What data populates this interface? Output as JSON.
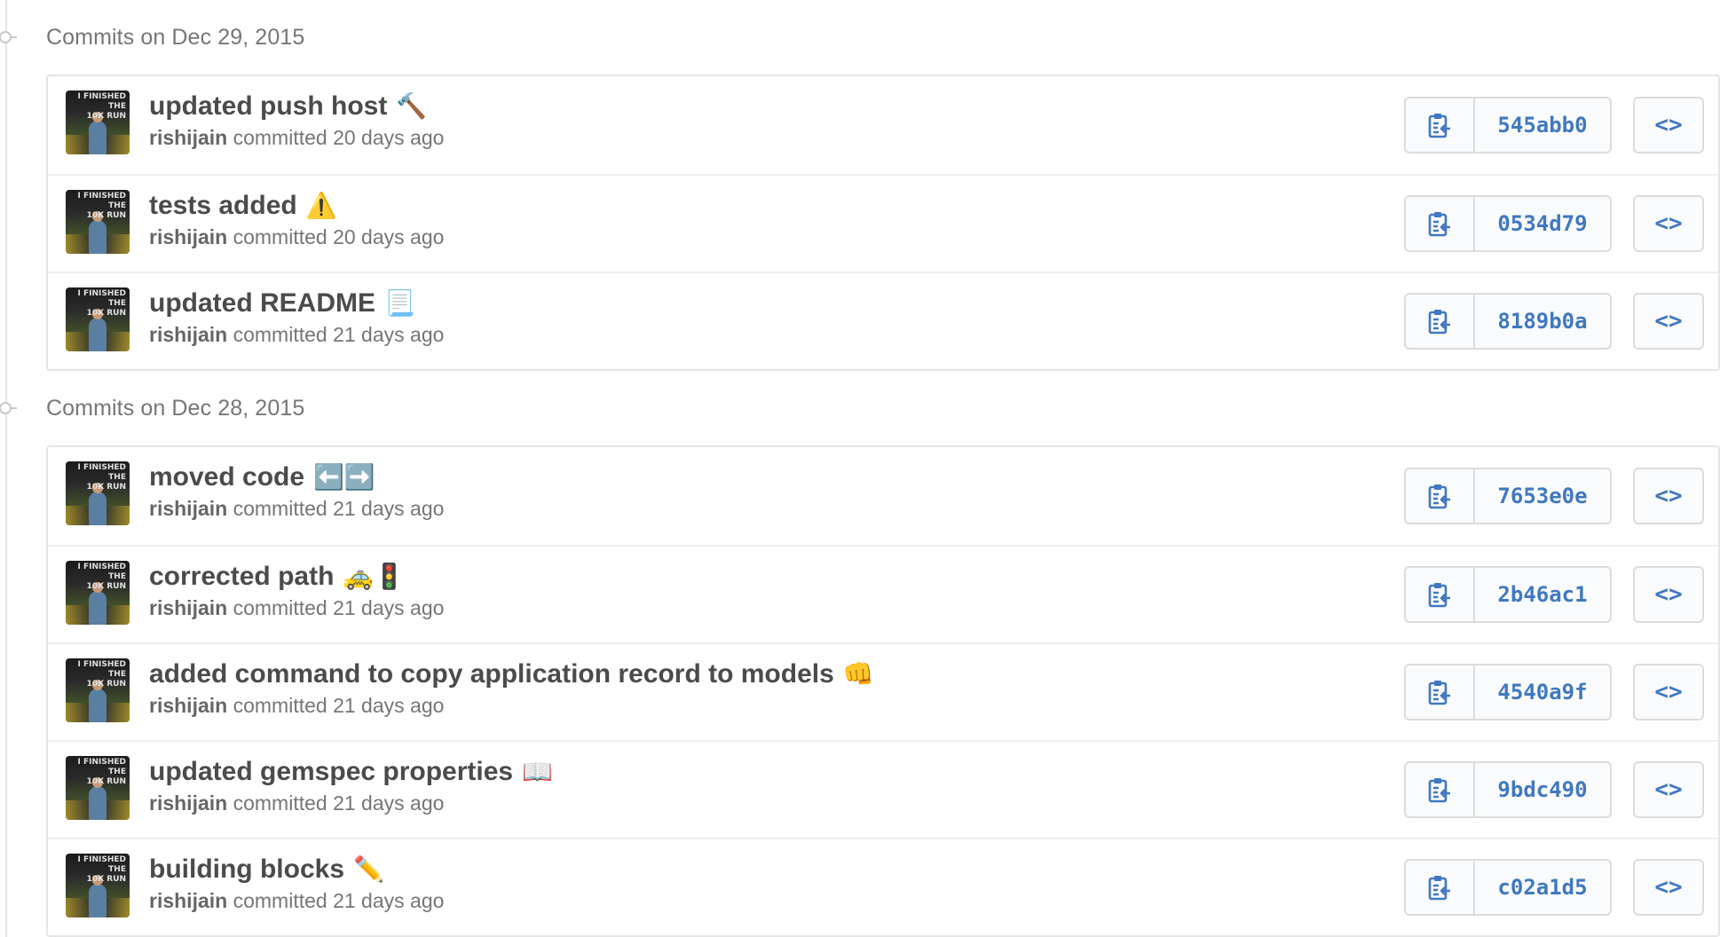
{
  "groups": [
    {
      "title": "Commits on Dec 29, 2015",
      "commits": [
        {
          "message": "updated push host",
          "emoji": "🔨",
          "author": "rishijain",
          "verb": "committed",
          "time": "20 days ago",
          "sha": "545abb0"
        },
        {
          "message": "tests added",
          "emoji": "⚠️",
          "author": "rishijain",
          "verb": "committed",
          "time": "20 days ago",
          "sha": "0534d79"
        },
        {
          "message": "updated README",
          "emoji": "📃",
          "author": "rishijain",
          "verb": "committed",
          "time": "21 days ago",
          "sha": "8189b0a"
        }
      ]
    },
    {
      "title": "Commits on Dec 28, 2015",
      "commits": [
        {
          "message": "moved code",
          "emoji": "⬅️➡️",
          "author": "rishijain",
          "verb": "committed",
          "time": "21 days ago",
          "sha": "7653e0e"
        },
        {
          "message": "corrected path",
          "emoji": "🚕🚦",
          "author": "rishijain",
          "verb": "committed",
          "time": "21 days ago",
          "sha": "2b46ac1"
        },
        {
          "message": "added command to copy application record to models",
          "emoji": "👊",
          "author": "rishijain",
          "verb": "committed",
          "time": "21 days ago",
          "sha": "4540a9f"
        },
        {
          "message": "updated gemspec properties",
          "emoji": "📖",
          "author": "rishijain",
          "verb": "committed",
          "time": "21 days ago",
          "sha": "9bdc490"
        },
        {
          "message": "building blocks",
          "emoji": "✏️",
          "author": "rishijain",
          "verb": "committed",
          "time": "21 days ago",
          "sha": "c02a1d5"
        }
      ]
    }
  ],
  "avatar": {
    "line1": "I FINISHED THE",
    "line2": "10K RUN"
  },
  "icons": {
    "copy": "clippy-icon",
    "browse": "code-icon"
  },
  "browse_glyph": "<>",
  "colors": {
    "link": "#4078c0",
    "muted": "#767676",
    "title": "#4b4b4b",
    "border": "#e5e5e5"
  }
}
